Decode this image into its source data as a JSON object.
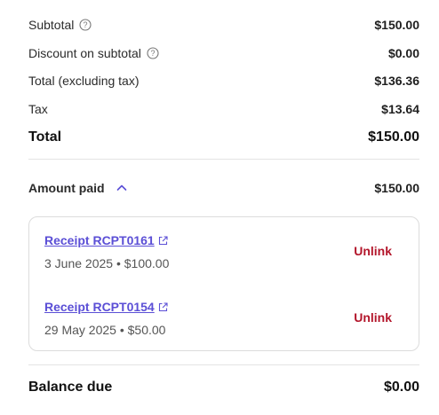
{
  "summary": {
    "subtotal_label": "Subtotal",
    "subtotal_value": "$150.00",
    "discount_label": "Discount on subtotal",
    "discount_value": "$0.00",
    "total_excl_label": "Total (excluding tax)",
    "total_excl_value": "$136.36",
    "tax_label": "Tax",
    "tax_value": "$13.64",
    "total_label": "Total",
    "total_value": "$150.00"
  },
  "amount_paid": {
    "label": "Amount paid",
    "value": "$150.00",
    "expanded": true
  },
  "receipts": [
    {
      "title": "Receipt RCPT0161",
      "meta": "3 June 2025 • $100.00",
      "action": "Unlink"
    },
    {
      "title": "Receipt RCPT0154",
      "meta": "29 May 2025 • $50.00",
      "action": "Unlink"
    }
  ],
  "balance": {
    "label": "Balance due",
    "value": "$0.00"
  },
  "colors": {
    "link": "#5b4fd6",
    "danger": "#b3162b",
    "border": "#dcdcdc"
  },
  "icons": {
    "info": "info-circle-icon",
    "chevron": "chevron-up-icon",
    "external": "external-link-icon"
  }
}
